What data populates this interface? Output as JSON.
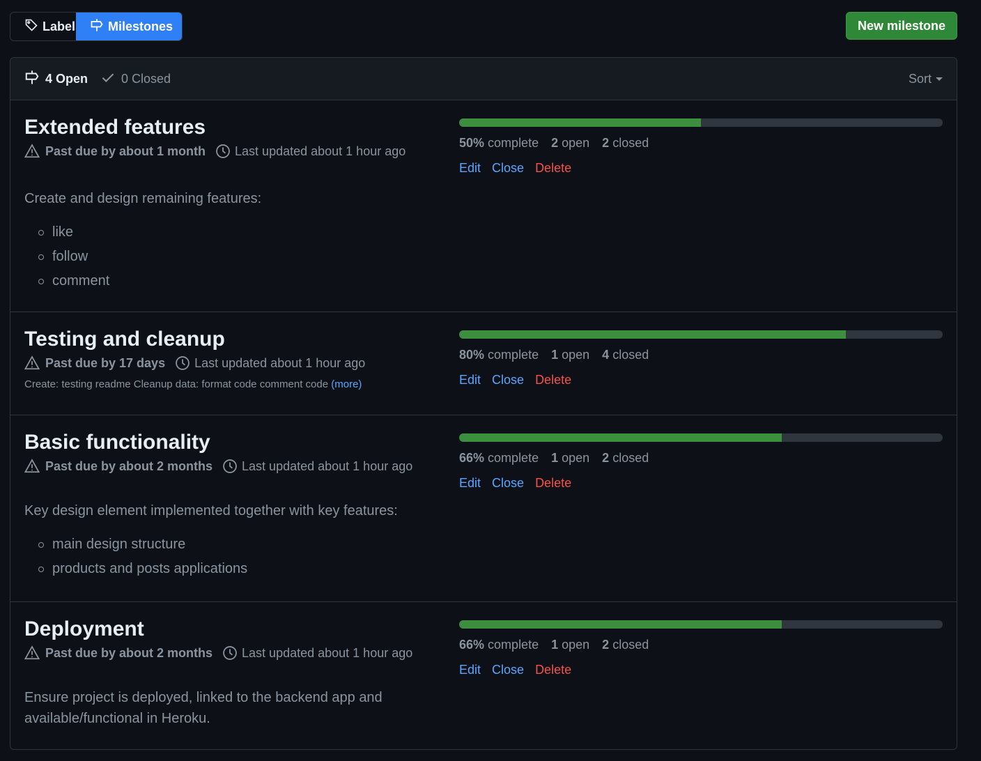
{
  "tabs": {
    "labels": "Labels",
    "milestones": "Milestones"
  },
  "new_milestone_label": "New milestone",
  "header": {
    "open_label": "4 Open",
    "closed_label": "0 Closed",
    "sort_label": "Sort"
  },
  "colors": {
    "accent": "#2f7ff6",
    "progress": "#3c8f3e",
    "danger": "#f85149",
    "link": "#58a6ff"
  },
  "milestones": [
    {
      "title": "Extended features",
      "due": "Past due by about 1 month",
      "updated": "Last updated about 1 hour ago",
      "description": "Create and design remaining features:",
      "items": [
        "like",
        "follow",
        "comment"
      ],
      "percent": "50%",
      "percent_value": 0.5,
      "open_count": "2",
      "closed_count": "2",
      "complete_label": "complete",
      "open_label": "open",
      "closed_label": "closed",
      "edit": "Edit",
      "close": "Close",
      "delete": "Delete"
    },
    {
      "title": "Testing and cleanup",
      "due": "Past due by 17 days",
      "updated": "Last updated about 1 hour ago",
      "description": "Create: testing readme Cleanup data: format code comment code",
      "more": "(more)",
      "percent": "80%",
      "percent_value": 0.8,
      "open_count": "1",
      "closed_count": "4",
      "complete_label": "complete",
      "open_label": "open",
      "closed_label": "closed",
      "edit": "Edit",
      "close": "Close",
      "delete": "Delete"
    },
    {
      "title": "Basic functionality",
      "due": "Past due by about 2 months",
      "updated": "Last updated about 1 hour ago",
      "description": "Key design element implemented together with key features:",
      "items": [
        "main design structure",
        "products and posts applications"
      ],
      "percent": "66%",
      "percent_value": 0.667,
      "open_count": "1",
      "closed_count": "2",
      "complete_label": "complete",
      "open_label": "open",
      "closed_label": "closed",
      "edit": "Edit",
      "close": "Close",
      "delete": "Delete"
    },
    {
      "title": "Deployment",
      "due": "Past due by about 2 months",
      "updated": "Last updated about 1 hour ago",
      "description": "Ensure project is deployed, linked to the backend app and available/functional in Heroku.",
      "percent": "66%",
      "percent_value": 0.667,
      "open_count": "1",
      "closed_count": "2",
      "complete_label": "complete",
      "open_label": "open",
      "closed_label": "closed",
      "edit": "Edit",
      "close": "Close",
      "delete": "Delete"
    }
  ]
}
